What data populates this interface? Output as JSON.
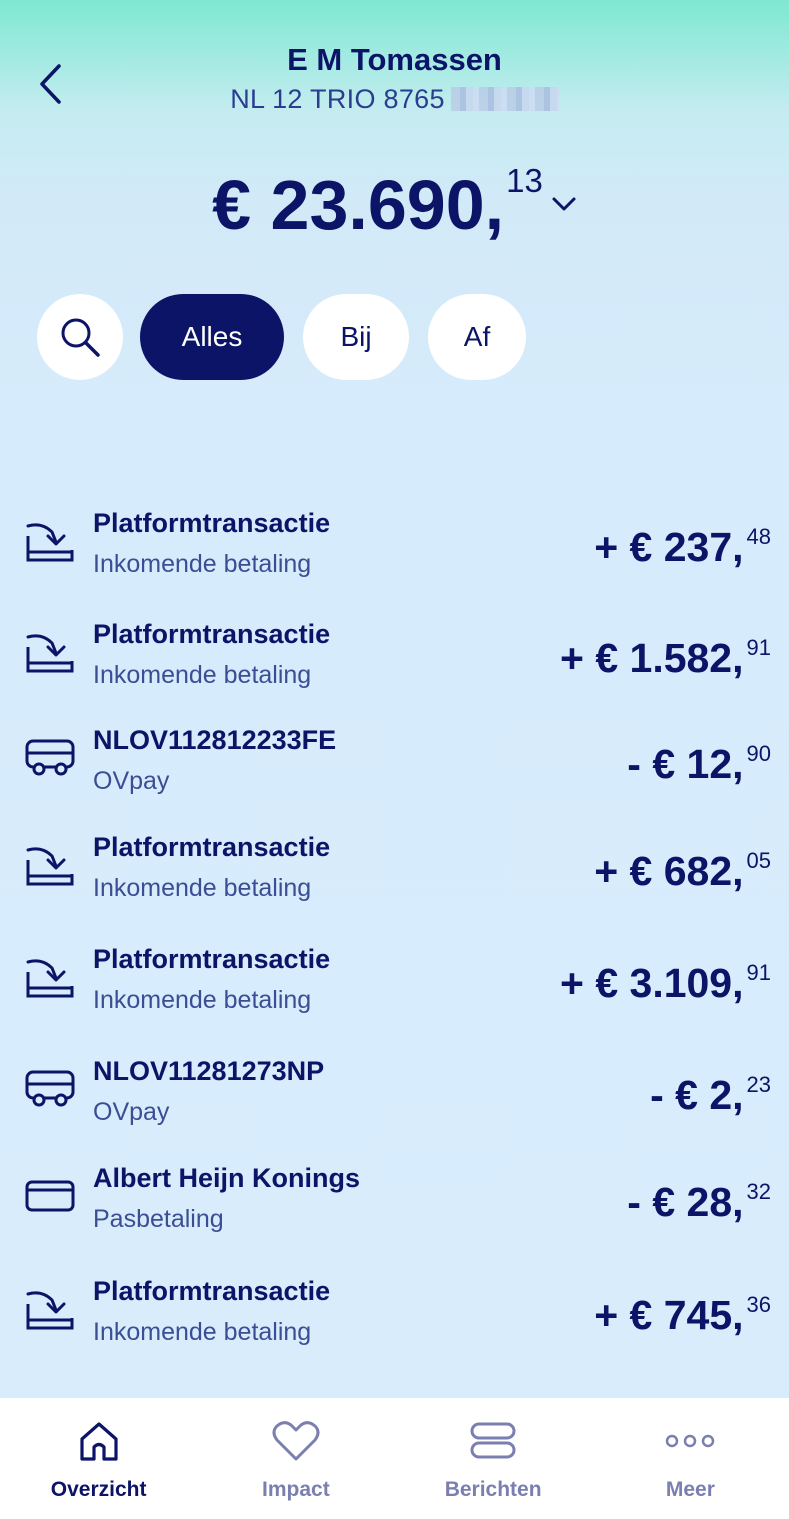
{
  "header": {
    "title": "E M Tomassen",
    "iban": "NL 12 TRIO 8765"
  },
  "balance": {
    "whole": "€ 23.690,",
    "cents": "13"
  },
  "filters": {
    "alles": "Alles",
    "bij": "Bij",
    "af": "Af"
  },
  "transactions": [
    {
      "name": "Platformtransactie",
      "type": "Inkomende betaling",
      "amount": "+ € 237,",
      "cents": "48",
      "icon": "incoming-icon"
    },
    {
      "name": "Platformtransactie",
      "type": "Inkomende betaling",
      "amount": "+ € 1.582,",
      "cents": "91",
      "icon": "incoming-icon"
    },
    {
      "name": "NLOV112812233FE",
      "type": "OVpay",
      "amount": "- € 12,",
      "cents": "90",
      "icon": "bus-icon"
    },
    {
      "name": "Platformtransactie",
      "type": "Inkomende betaling",
      "amount": "+ € 682,",
      "cents": "05",
      "icon": "incoming-icon"
    },
    {
      "name": "Platformtransactie",
      "type": "Inkomende betaling",
      "amount": "+ € 3.109,",
      "cents": "91",
      "icon": "incoming-icon"
    },
    {
      "name": "NLOV11281273NP",
      "type": "OVpay",
      "amount": "- € 2,",
      "cents": "23",
      "icon": "bus-icon"
    },
    {
      "name": "Albert Heijn Konings",
      "type": "Pasbetaling",
      "amount": "- € 28,",
      "cents": "32",
      "icon": "card-icon"
    },
    {
      "name": "Platformtransactie",
      "type": "Inkomende betaling",
      "amount": "+ € 745,",
      "cents": "36",
      "icon": "incoming-icon"
    }
  ],
  "tabbar": {
    "overzicht": "Overzicht",
    "impact": "Impact",
    "berichten": "Berichten",
    "meer": "Meer"
  },
  "colors": {
    "primary": "#0b1466",
    "secondary_text": "#3b4e94",
    "inactive_tab": "#7a7fb0",
    "gradient_top": "#7ee8d2",
    "background": "#d8ecfc"
  }
}
